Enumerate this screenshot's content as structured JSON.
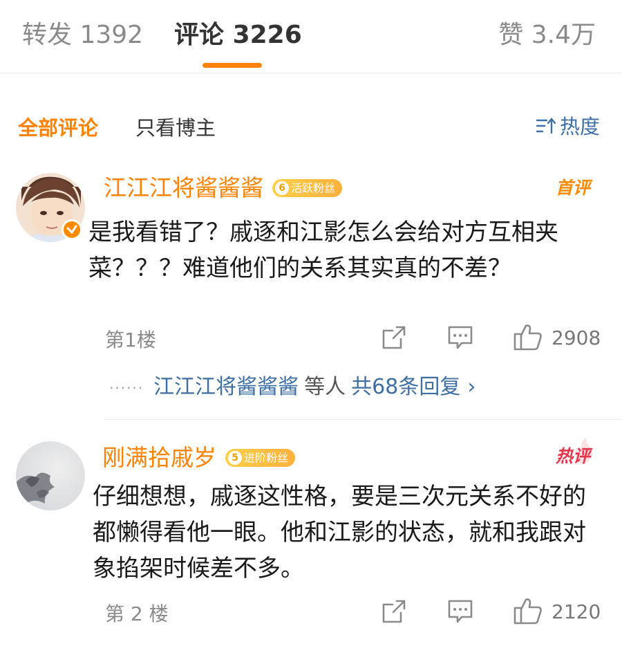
{
  "tabs": {
    "forward_label": "转发",
    "forward_count": "1392",
    "comments_label": "评论",
    "comments_count": "3226",
    "likes_label": "赞",
    "likes_count": "3.4万"
  },
  "filter": {
    "all_label": "全部评论",
    "poster_only_label": "只看博主",
    "sort_label": "热度",
    "sort_icon": "sort-icon"
  },
  "colors": {
    "accent": "#ff8200",
    "link": "#3d6fa5",
    "hot_tag": "#e8354a"
  },
  "comments": [
    {
      "username": "江江江将酱酱酱",
      "fan_level": "6",
      "fan_badge": "活跃粉丝",
      "tag": "首评",
      "text": "是我看错了？戚逐和江影怎么会给对方互相夹菜？？？难道他们的关系其实真的不差？",
      "floor": "第1楼",
      "likes": "2908",
      "replies": {
        "name": "江江江将酱酱酱",
        "mid": "等人",
        "total": "共68条回复",
        "chevron": "›"
      }
    },
    {
      "username": "刚满拾戚岁",
      "fan_level": "5",
      "fan_badge": "进阶粉丝",
      "tag": "热评",
      "text": "仔细想想，戚逐这性格，要是三次元关系不好的都懒得看他一眼。他和江影的状态，就和我跟对象掐架时候差不多。",
      "floor": "第 2 楼",
      "likes": "2120"
    }
  ]
}
